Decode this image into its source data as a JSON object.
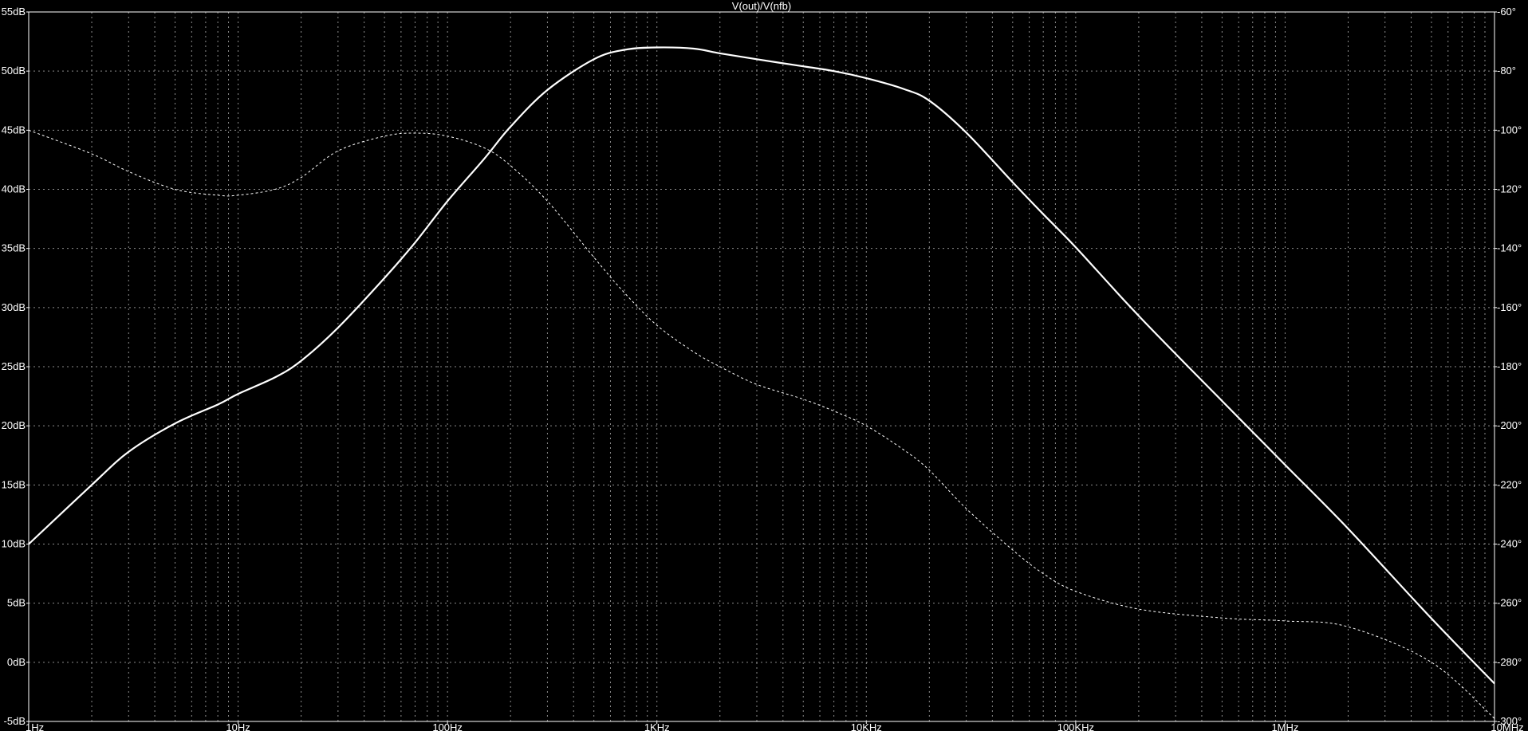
{
  "chart_data": {
    "type": "line",
    "title": "V(out)/V(nfb)",
    "x_scale": "log",
    "xlim": [
      1,
      10000000
    ],
    "x_ticks": [
      {
        "value": 1,
        "label": "1Hz"
      },
      {
        "value": 10,
        "label": "10Hz"
      },
      {
        "value": 100,
        "label": "100Hz"
      },
      {
        "value": 1000,
        "label": "1KHz"
      },
      {
        "value": 10000,
        "label": "10KHz"
      },
      {
        "value": 100000,
        "label": "100KHz"
      },
      {
        "value": 1000000,
        "label": "1MHz"
      },
      {
        "value": 10000000,
        "label": "10MHz"
      }
    ],
    "ylim_left": [
      -5,
      55
    ],
    "y_ticks_left": [
      {
        "value": 55,
        "label": "55dB"
      },
      {
        "value": 50,
        "label": "50dB"
      },
      {
        "value": 45,
        "label": "45dB"
      },
      {
        "value": 40,
        "label": "40dB"
      },
      {
        "value": 35,
        "label": "35dB"
      },
      {
        "value": 30,
        "label": "30dB"
      },
      {
        "value": 25,
        "label": "25dB"
      },
      {
        "value": 20,
        "label": "20dB"
      },
      {
        "value": 15,
        "label": "15dB"
      },
      {
        "value": 10,
        "label": "10dB"
      },
      {
        "value": 5,
        "label": "5dB"
      },
      {
        "value": 0,
        "label": "0dB"
      },
      {
        "value": -5,
        "label": "-5dB"
      }
    ],
    "ylim_right": [
      -300,
      -60
    ],
    "y_ticks_right": [
      {
        "value": -60,
        "label": "-60°"
      },
      {
        "value": -80,
        "label": "-80°"
      },
      {
        "value": -100,
        "label": "-100°"
      },
      {
        "value": -120,
        "label": "-120°"
      },
      {
        "value": -140,
        "label": "-140°"
      },
      {
        "value": -160,
        "label": "-160°"
      },
      {
        "value": -180,
        "label": "-180°"
      },
      {
        "value": -200,
        "label": "-200°"
      },
      {
        "value": -220,
        "label": "-220°"
      },
      {
        "value": -240,
        "label": "-240°"
      },
      {
        "value": -260,
        "label": "-260°"
      },
      {
        "value": -280,
        "label": "-280°"
      },
      {
        "value": -300,
        "label": "-300°"
      }
    ],
    "grid": true,
    "colors": {
      "background": "#000000",
      "grid": "#8c8c8c",
      "trace": "#ffffff",
      "text": "#ffffff"
    },
    "series": [
      {
        "axis": "left",
        "style": "solid",
        "x": [
          1,
          2,
          3,
          5,
          8,
          10,
          15,
          20,
          30,
          50,
          70,
          100,
          150,
          200,
          300,
          500,
          700,
          1000,
          1500,
          2000,
          3000,
          5000,
          7000,
          10000,
          15000,
          20000,
          30000,
          50000,
          70000,
          100000,
          200000,
          500000,
          1000000,
          2000000,
          5000000,
          10000000
        ],
        "y": [
          10,
          15,
          17.8,
          20.2,
          21.8,
          22.7,
          24.1,
          25.5,
          28.3,
          32.5,
          35.5,
          39,
          42.6,
          45.3,
          48.4,
          51,
          51.8,
          52,
          51.9,
          51.5,
          51,
          50.4,
          50,
          49.4,
          48.5,
          47.5,
          44.8,
          40.6,
          37.9,
          35.1,
          29.3,
          22.1,
          16.7,
          11.3,
          3.7,
          -1.8
        ]
      },
      {
        "axis": "right",
        "style": "dashed",
        "x": [
          1,
          2,
          3,
          5,
          8,
          10,
          15,
          20,
          30,
          50,
          70,
          100,
          150,
          200,
          300,
          500,
          700,
          1000,
          1500,
          2000,
          3000,
          5000,
          7000,
          10000,
          15000,
          20000,
          30000,
          50000,
          70000,
          100000,
          200000,
          500000,
          1000000,
          2000000,
          5000000,
          10000000
        ],
        "y": [
          -100,
          -108,
          -114,
          -120,
          -122,
          -122,
          -120,
          -116,
          -107,
          -102,
          -101,
          -102,
          -106,
          -112,
          -124,
          -143,
          -155,
          -166,
          -175,
          -180,
          -186,
          -191,
          -195,
          -200,
          -208,
          -215,
          -228,
          -242,
          -250,
          -256,
          -262,
          -265,
          -266,
          -268,
          -280,
          -299
        ]
      }
    ]
  }
}
